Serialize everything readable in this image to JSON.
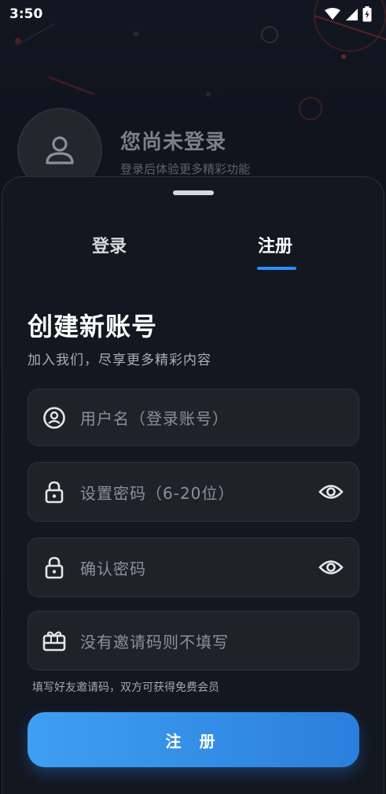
{
  "status_bar": {
    "time": "3:50",
    "icons": [
      "wifi-icon",
      "signal-icon",
      "battery-icon"
    ]
  },
  "profile": {
    "title": "您尚未登录",
    "subtitle": "登录后体验更多精彩功能",
    "avatar_icon": "user-icon"
  },
  "tabs": {
    "login": "登录",
    "register": "注册",
    "active": "register",
    "accent": "#2f8cff"
  },
  "form": {
    "title": "创建新账号",
    "subtitle": "加入我们，尽享更多精彩内容",
    "username_placeholder": "用户名（登录账号）",
    "password_placeholder": "设置密码（6-20位）",
    "confirm_placeholder": "确认密码",
    "invite_placeholder": "没有邀请码则不填写",
    "invite_hint": "填写好友邀请码，双方可获得免费会员",
    "submit_label": "注 册",
    "icons": {
      "username": "user-circle-icon",
      "password": "lock-icon",
      "confirm": "lock-icon",
      "invite": "gift-card-icon",
      "toggle": "eye-icon"
    }
  }
}
